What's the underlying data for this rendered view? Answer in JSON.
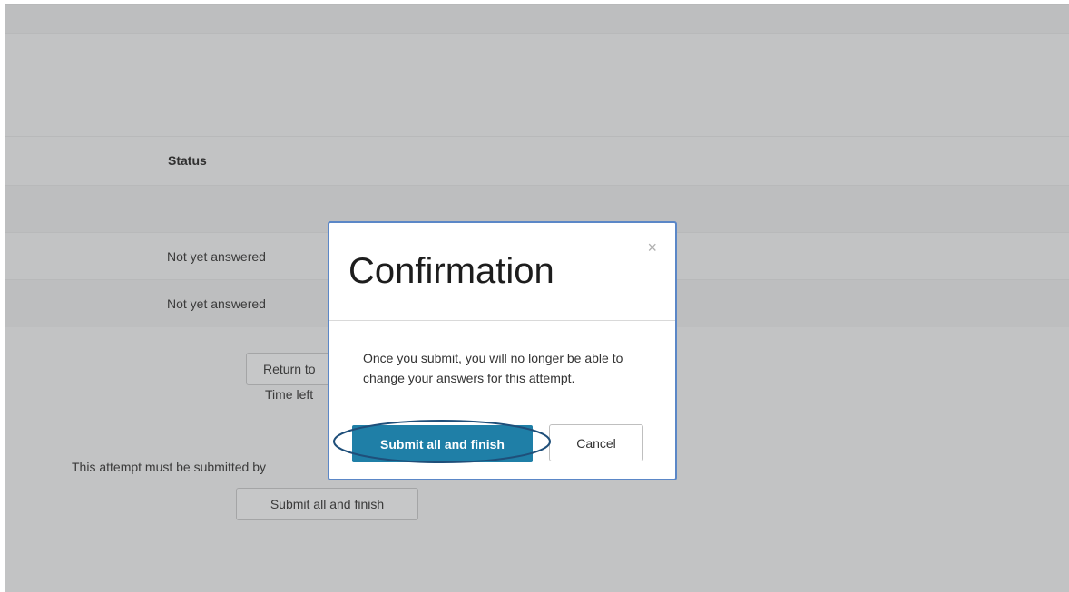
{
  "table": {
    "status_header": "Status",
    "questions": [
      {
        "status": "Not yet answered"
      },
      {
        "status": "Not yet answered"
      }
    ]
  },
  "summary": {
    "return_button_label": "Return to",
    "time_left_label": "Time left",
    "attempt_deadline_text": "This attempt must be submitted by",
    "submit_button_label": "Submit all and finish"
  },
  "modal": {
    "title": "Confirmation",
    "close_glyph": "×",
    "body": "Once you submit, you will no longer be able to change your answers for this attempt.",
    "submit_label": "Submit all and finish",
    "cancel_label": "Cancel"
  },
  "colors": {
    "primary": "#1f7fa7",
    "overlay": "#c2c3c4",
    "modal_border": "#5b87c7",
    "highlight": "#1f4f7a"
  }
}
